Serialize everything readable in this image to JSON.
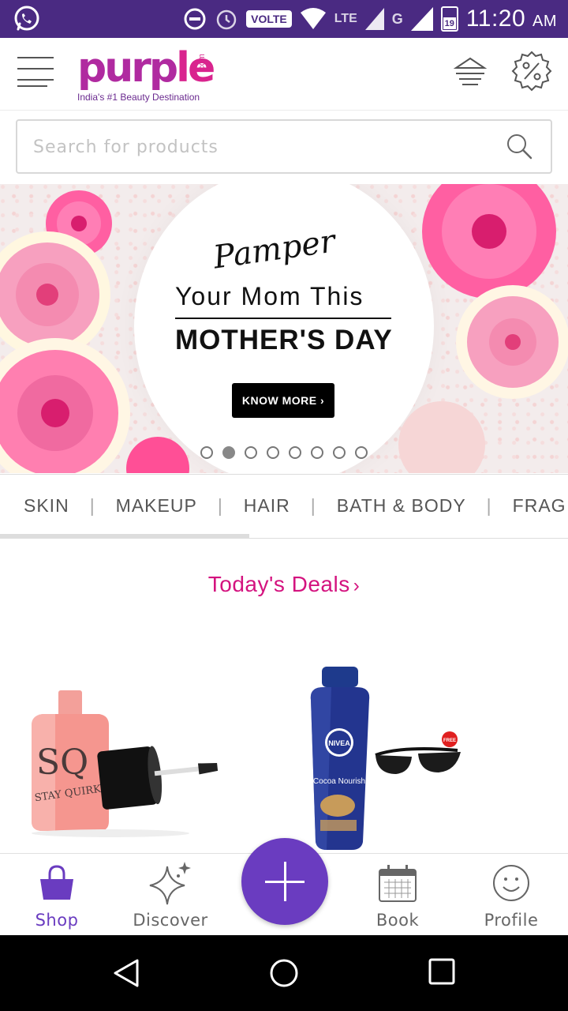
{
  "status_bar": {
    "volte": "VOLTE",
    "network_lte": "LTE",
    "network_g": "G",
    "battery": "19",
    "time": "11:20",
    "ampm": "AM",
    "bg_color": "#4a2a82"
  },
  "app_bar": {
    "logo_text": "purple",
    "logo_suffix": ".com",
    "tagline": "India's #1 Beauty Destination",
    "icons": [
      "menu-icon",
      "filter-icon",
      "offer-percent-icon"
    ]
  },
  "search": {
    "placeholder": "Search for products"
  },
  "banner": {
    "script": "Pamper",
    "line1": "Your Mom This",
    "line2": "MOTHER'S DAY",
    "cta": "KNOW MORE ›",
    "slides_total": 8,
    "active_slide": 1
  },
  "categories": {
    "items": [
      "SKIN",
      "MAKEUP",
      "HAIR",
      "BATH & BODY",
      "FRAG"
    ],
    "separator": "|"
  },
  "deals": {
    "title": "Today's Deals",
    "chevron": "›",
    "accent": "#d4137f"
  },
  "products": [
    {
      "brand_label": "SQ",
      "sub_label": "STAY QUIRKY"
    },
    {
      "brand_label": "NIVEA",
      "sub_label": "Cocoa Nourish",
      "badge": "FREE"
    }
  ],
  "tab_bar": {
    "tabs": [
      {
        "label": "Shop",
        "icon": "shopping-bag-icon",
        "active": true
      },
      {
        "label": "Discover",
        "icon": "sparkle-icon",
        "active": false
      },
      {
        "label": "Book",
        "icon": "calendar-icon",
        "active": false
      },
      {
        "label": "Profile",
        "icon": "smiley-icon",
        "active": false
      }
    ],
    "fab_icon": "plus-icon",
    "accent": "#6a3cc0"
  }
}
